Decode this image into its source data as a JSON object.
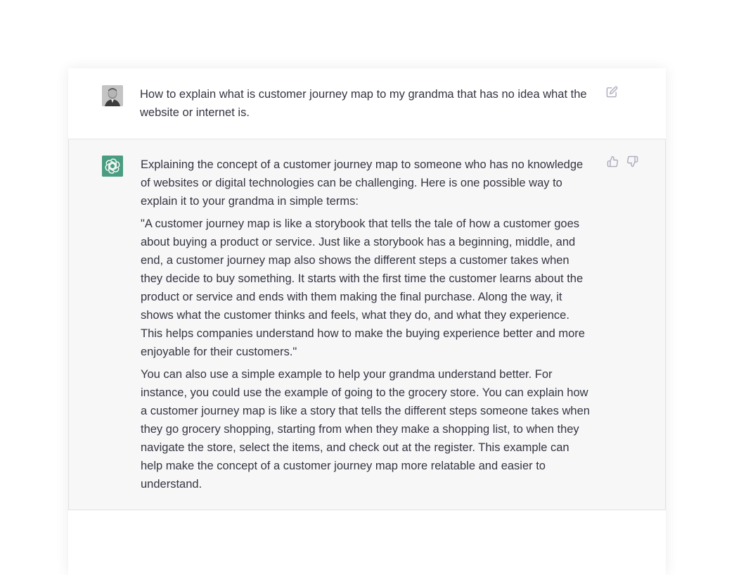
{
  "conversation": {
    "user_message": {
      "text": "How to explain what is customer journey map to my grandma that has no idea what the website or internet is."
    },
    "assistant_message": {
      "paragraphs": [
        "Explaining the concept of a customer journey map to someone who has no knowledge of websites or digital technologies can be challenging. Here is one possible way to explain it to your grandma in simple terms:",
        "\"A customer journey map is like a storybook that tells the tale of how a customer goes about buying a product or service. Just like a storybook has a beginning, middle, and end, a customer journey map also shows the different steps a customer takes when they decide to buy something. It starts with the first time the customer learns about the product or service and ends with them making the final purchase. Along the way, it shows what the customer thinks and feels, what they do, and what they experience. This helps companies understand how to make the buying experience better and more enjoyable for their customers.\"",
        "You can also use a simple example to help your grandma understand better. For instance, you could use the example of going to the grocery store. You can explain how a customer journey map is like a story that tells the different steps someone takes when they go grocery shopping, starting from when they make a shopping list, to when they navigate the store, select the items, and check out at the register. This example can help make the concept of a customer journey map more relatable and easier to understand."
      ]
    }
  },
  "icons": {
    "user_avatar": "user-avatar-photo",
    "assistant_avatar": "openai-logo-icon",
    "edit": "edit-icon",
    "thumbs_up": "thumbs-up-icon",
    "thumbs_down": "thumbs-down-icon"
  },
  "colors": {
    "assistant_background": "#f7f7f8",
    "assistant_avatar_background": "#4a9d81",
    "text": "#343541",
    "icon": "#acacbe"
  }
}
